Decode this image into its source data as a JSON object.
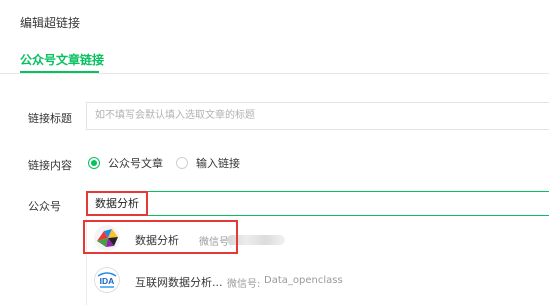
{
  "dialog": {
    "title": "编辑超链接"
  },
  "tabs": [
    {
      "label": "公众号文章链接",
      "active": true
    }
  ],
  "link_title": {
    "label": "链接标题",
    "placeholder": "如不填写会默认填入选取文章的标题"
  },
  "link_content": {
    "label": "链接内容",
    "options": [
      {
        "label": "公众号文章",
        "selected": true
      },
      {
        "label": "输入链接",
        "selected": false
      }
    ]
  },
  "account": {
    "label": "公众号",
    "value": "数据分析"
  },
  "results": [
    {
      "name": "数据分析",
      "wechat_label": "微信号:",
      "wechat_id": "",
      "avatar": "colorful-badge-icon"
    },
    {
      "name": "互联网数据分析...",
      "wechat_label": "微信号:",
      "wechat_id": "Data_openclass",
      "avatar": "ida-logo-icon"
    }
  ],
  "colors": {
    "accent": "#07c160",
    "highlight": "#e53935"
  }
}
